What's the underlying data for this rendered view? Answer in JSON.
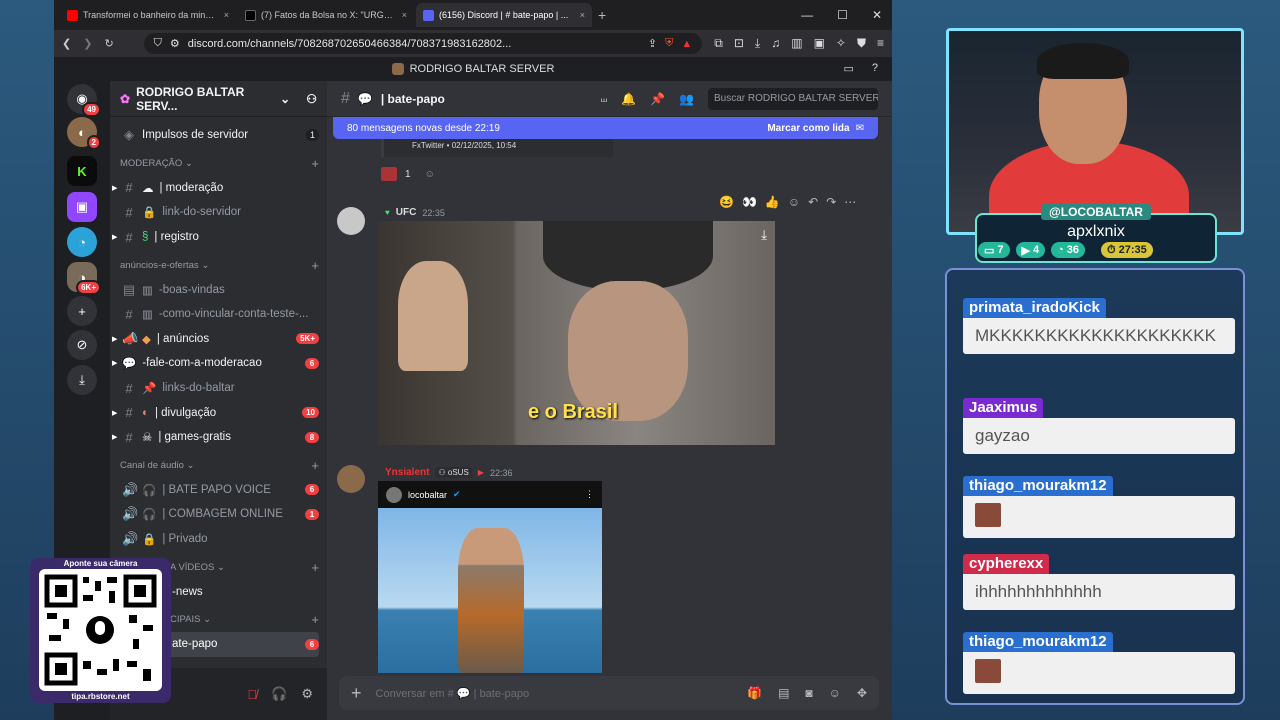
{
  "browser": {
    "tabs": [
      {
        "title": "Transformei o banheiro da minha mãe e da...",
        "close": "×",
        "color": "#ff0000"
      },
      {
        "title": "(7) Fatos da Bolsa no X: \"URGENTE: Acabou...",
        "close": "×",
        "color": "#000000"
      },
      {
        "title": "(6156) Discord | # bate-papo | ...",
        "close": "×",
        "color": "#5865f2"
      }
    ],
    "new_tab": "+",
    "window_controls": [
      "—",
      "☐",
      "✕"
    ],
    "url": "discord.com/channels/708268702650466384/708371983162802...",
    "shield_badge": "1"
  },
  "discord": {
    "window_title": "RODRIGO BALTAR SERVER",
    "guild_badges": [
      "49",
      "2",
      "6K+"
    ],
    "server_name": "RODRIGO BALTAR SERV...",
    "boosts_label": "Impulsos de servidor",
    "boosts_count": "1",
    "categories": {
      "moderacao": "MODERAÇÃO",
      "anuncios": "anúncios-e-ofertas",
      "audio": "Canal de áudio",
      "videos": "A VÍDEOS",
      "principais": "CIPAIS"
    },
    "channels": {
      "moderacao": "| moderação",
      "link_servidor": "link-do-servidor",
      "registro": "| registro",
      "boas_vindas": "-boas-vindas",
      "vincular": "-como-vincular-conta-teste-...",
      "anuncios": "| anúncios",
      "anuncios_badge": "5K+",
      "fale": "-fale-com-a-moderacao",
      "fale_badge": "6",
      "links_baltar": "links-do-baltar",
      "divulgacao": "| divulgação",
      "divulgacao_badge": "10",
      "games": "| games-gratis",
      "games_badge": "8",
      "bate_voice": "| BATE PAPO VOICE",
      "bate_voice_badge": "6",
      "combagem": "| COMBAGEM ONLINE",
      "combagem_badge": "1",
      "privado": "| Privado",
      "news": "-news",
      "bate_papo": "ate-papo",
      "bate_papo_badge": "6"
    },
    "channel_header": "| bate-papo",
    "search_placeholder": "Buscar RODRIGO BALTAR SERVER",
    "new_messages": "80 mensagens novas desde 22:19",
    "mark_read": "Marcar como lida",
    "embed_source": "FxTwitter • 02/12/2025, 10:54",
    "reaction_count": "1",
    "msg1_user": "UFC",
    "msg1_time": "22:35",
    "msg1_caption": "e o Brasil",
    "msg2_user": "Ynsialent",
    "msg2_tag": "oSUS",
    "msg2_time": "22:36",
    "msg2_embed_user": "locobaltar",
    "composer_placeholder": "Conversar em #",
    "composer_channel": "bate-papo"
  },
  "stream": {
    "handle": "@LOCOBALTAR",
    "sub_handle": "apxlxnix",
    "stats": [
      {
        "value": "7",
        "color": "#24b89a"
      },
      {
        "value": "4",
        "color": "#24b89a"
      },
      {
        "value": "36",
        "color": "#24b89a"
      },
      {
        "value": "27:35",
        "color": "#d8c53a"
      }
    ],
    "chat": [
      {
        "user": "primata_iradoKick",
        "text": "MKKKKKKKKKKKKKKKKKKKK",
        "color": "#2a6fd0"
      },
      {
        "user": "Jaaximus",
        "text": "gayzao",
        "color": "#7a2bd0"
      },
      {
        "user": "thiago_mourakm12",
        "text": "",
        "color": "#2a6fd0"
      },
      {
        "user": "cypherexx",
        "text": "ihhhhhhhhhhhhh",
        "color": "#d02b4a"
      },
      {
        "user": "thiago_mourakm12",
        "text": "",
        "color": "#2a6fd0"
      }
    ],
    "qr_top": "Aponte sua câmera",
    "qr_bottom": "tipa.rbstore.net"
  }
}
